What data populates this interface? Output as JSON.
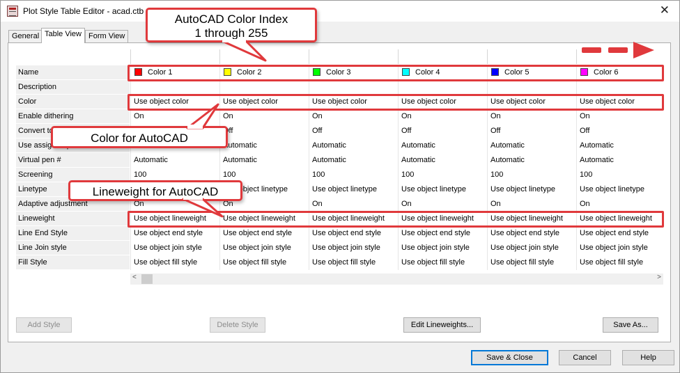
{
  "window": {
    "title": "Plot Style Table Editor - acad.ctb",
    "close_glyph": "✕"
  },
  "tabs": [
    {
      "label": "General",
      "active": false
    },
    {
      "label": "Table View",
      "active": true
    },
    {
      "label": "Form View",
      "active": false
    }
  ],
  "table": {
    "columns": [
      {
        "name": "Color 1",
        "swatch": "#ff0000"
      },
      {
        "name": "Color 2",
        "swatch": "#ffff00"
      },
      {
        "name": "Color 3",
        "swatch": "#00ff00"
      },
      {
        "name": "Color 4",
        "swatch": "#00ffff"
      },
      {
        "name": "Color 5",
        "swatch": "#0000ff"
      },
      {
        "name": "Color 6",
        "swatch": "#ff00ff"
      }
    ],
    "rows": [
      {
        "label": "Name",
        "values": []
      },
      {
        "label": "Description",
        "values": [
          "",
          "",
          "",
          "",
          "",
          ""
        ]
      },
      {
        "label": "Color",
        "values": [
          "Use object color",
          "Use object color",
          "Use object color",
          "Use object color",
          "Use object color",
          "Use object color"
        ]
      },
      {
        "label": "Enable dithering",
        "values": [
          "On",
          "On",
          "On",
          "On",
          "On",
          "On"
        ]
      },
      {
        "label": "Convert to grayscale",
        "values": [
          "Off",
          "Off",
          "Off",
          "Off",
          "Off",
          "Off"
        ]
      },
      {
        "label": "Use assigned pen #",
        "values": [
          "Automatic",
          "Automatic",
          "Automatic",
          "Automatic",
          "Automatic",
          "Automatic"
        ]
      },
      {
        "label": "Virtual pen #",
        "values": [
          "Automatic",
          "Automatic",
          "Automatic",
          "Automatic",
          "Automatic",
          "Automatic"
        ]
      },
      {
        "label": "Screening",
        "values": [
          "100",
          "100",
          "100",
          "100",
          "100",
          "100"
        ]
      },
      {
        "label": "Linetype",
        "values": [
          "Use object linetype",
          "Use object linetype",
          "Use object linetype",
          "Use object linetype",
          "Use object linetype",
          "Use object linetype"
        ]
      },
      {
        "label": "Adaptive adjustment",
        "values": [
          "On",
          "On",
          "On",
          "On",
          "On",
          "On"
        ]
      },
      {
        "label": "Lineweight",
        "values": [
          "Use object lineweight",
          "Use object lineweight",
          "Use object lineweight",
          "Use object lineweight",
          "Use object lineweight",
          "Use object lineweight"
        ]
      },
      {
        "label": "Line End Style",
        "values": [
          "Use object end style",
          "Use object end style",
          "Use object end style",
          "Use object end style",
          "Use object end style",
          "Use object end style"
        ]
      },
      {
        "label": "Line Join style",
        "values": [
          "Use object join style",
          "Use object join style",
          "Use object join style",
          "Use object join style",
          "Use object join style",
          "Use object join style"
        ]
      },
      {
        "label": "Fill Style",
        "values": [
          "Use object fill style",
          "Use object fill style",
          "Use object fill style",
          "Use object fill style",
          "Use object fill style",
          "Use object fill style"
        ]
      }
    ]
  },
  "scrollbar": {
    "left_glyph": "<",
    "right_glyph": ">"
  },
  "buttons": {
    "add_style": "Add Style",
    "delete_style": "Delete Style",
    "edit_lineweights": "Edit Lineweights...",
    "save_as": "Save As...",
    "save_close": "Save & Close",
    "cancel": "Cancel",
    "help": "Help"
  },
  "annotations": {
    "color_index": {
      "line1": "AutoCAD Color Index",
      "line2": "1 through 255"
    },
    "color_for_autocad": "Color for AutoCAD",
    "lineweight_for_autocad": "Lineweight for AutoCAD",
    "accent": "#e0393c"
  }
}
